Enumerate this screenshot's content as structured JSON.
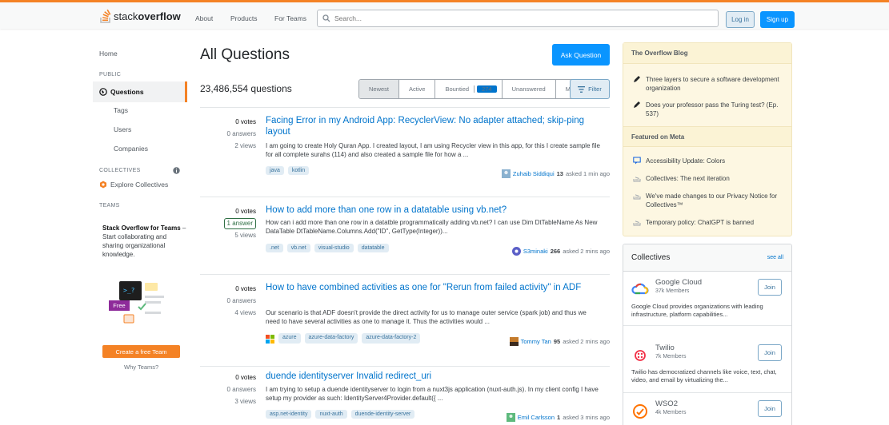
{
  "colors": {
    "accent": "#f48225",
    "primary": "#0a95ff",
    "link": "#0074cc"
  },
  "header": {
    "logo_light": "stack",
    "logo_bold": "overflow",
    "nav": [
      "About",
      "Products",
      "For Teams"
    ],
    "search_placeholder": "Search...",
    "login_label": "Log in",
    "signup_label": "Sign up"
  },
  "sidebar": {
    "home": "Home",
    "public_heading": "PUBLIC",
    "questions": "Questions",
    "tags": "Tags",
    "users": "Users",
    "companies": "Companies",
    "collectives_heading": "COLLECTIVES",
    "explore_collectives": "Explore Collectives",
    "teams_heading": "TEAMS",
    "teams_title": "Stack Overflow for Teams",
    "teams_text": " – Start collaborating and sharing organizational knowledge.",
    "free_badge": "Free",
    "create_team": "Create a free Team",
    "why_teams": "Why Teams?"
  },
  "main": {
    "title": "All Questions",
    "ask_button": "Ask Question",
    "question_count": "23,486,554 questions",
    "filters": [
      {
        "label": "Newest"
      },
      {
        "label": "Active"
      },
      {
        "label": "Bountied",
        "badge": "274"
      },
      {
        "label": "Unanswered"
      },
      {
        "label": "More ▾"
      }
    ],
    "filter_button": "Filter",
    "questions": [
      {
        "votes": "0 votes",
        "answers": "0 answers",
        "views": "2 views",
        "title": "Facing Error in my Android App: RecyclerView: No adapter attached; skip-ping layout",
        "excerpt": "I am going to create Holy Quran App. I created layout, I am using Recycler view in this app, for this I create sample file for all complete surahs (114) and also created a sample file for how a ...",
        "tags": [
          "java",
          "kotlin"
        ],
        "user": "Zuhaib Siddiqui",
        "rep": "13",
        "asked": "asked 1 min ago"
      },
      {
        "votes": "0 votes",
        "answers": "1 answer",
        "views": "5 views",
        "title": "How to add more than one row in a datatable using vb.net?",
        "excerpt": "How can i add more than one row in a datatble programmatically adding vb.net? I can use Dim DtTableName As New DataTable DtTableName.Columns.Add(\"ID\", GetType(Integer))...",
        "tags": [
          ".net",
          "vb.net",
          "visual-studio",
          "datatable"
        ],
        "user": "S3minaki",
        "rep": "266",
        "asked": "asked 2 mins ago"
      },
      {
        "votes": "0 votes",
        "answers": "0 answers",
        "views": "4 views",
        "title": "How to have combined activities as one for \"Rerun from failed activity\" in ADF",
        "excerpt": "Our scenario is that ADF doesn't provide the direct activity for us to manage outer service (spark job) and thus we need to have several activities as one to manage it. Thus the activities would ...",
        "tags": [
          "azure",
          "azure-data-factory",
          "azure-data-factory-2"
        ],
        "user": "Tommy Tan",
        "rep": "95",
        "asked": "asked 2 mins ago"
      },
      {
        "votes": "0 votes",
        "answers": "0 answers",
        "views": "3 views",
        "title": "duende identityserver Invalid redirect_uri",
        "excerpt": "I am trying to setup a duende identityserver to login from a nuxt3js application (nuxt-auth.js). In my client config I have setup my provider as such: IdentityServer4Provider.default({ ...",
        "tags": [
          "asp.net-identity",
          "nuxt-auth",
          "duende-identity-server"
        ],
        "user": "Emil Carlsson",
        "rep": "1",
        "asked": "asked 3 mins ago"
      }
    ]
  },
  "blog": {
    "heading": "The Overflow Blog",
    "items": [
      "Three layers to secure a software development organization",
      "Does your professor pass the Turing test? (Ep. 537)"
    ],
    "meta_heading": "Featured on Meta",
    "meta_items": [
      "Accessibility Update: Colors",
      "Collectives: The next iteration",
      "We've made changes to our Privacy Notice for Collectives™",
      "Temporary policy: ChatGPT is banned"
    ]
  },
  "collectives": {
    "heading": "Collectives",
    "see_all": "see all",
    "items": [
      {
        "name": "Google Cloud",
        "members": "37k Members",
        "join": "Join",
        "desc": "Google Cloud provides organizations with leading infrastructure, platform capabilities..."
      },
      {
        "name": "Twilio",
        "members": "7k Members",
        "join": "Join",
        "desc": "Twilio has democratized channels like voice, text, chat, video, and email by virtualizing the..."
      },
      {
        "name": "WSO2",
        "members": "4k Members",
        "join": "Join",
        "desc": ""
      }
    ]
  }
}
